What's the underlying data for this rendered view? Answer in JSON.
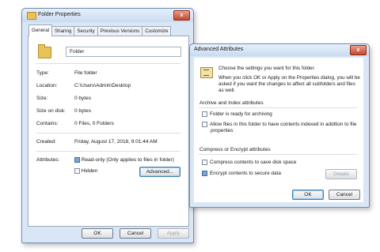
{
  "folder_properties": {
    "title": "Folder Properties",
    "close_label": "x",
    "tabs": [
      "General",
      "Sharing",
      "Security",
      "Previous Versions",
      "Customize"
    ],
    "name_value": "Folder",
    "fields": [
      {
        "label": "Type:",
        "value": "File folder"
      },
      {
        "label": "Location:",
        "value": "C:\\Users\\Admin\\Desktop"
      },
      {
        "label": "Size:",
        "value": "0 bytes"
      },
      {
        "label": "Size on disk:",
        "value": "0 bytes"
      },
      {
        "label": "Contains:",
        "value": "0 Files, 0 Folders"
      },
      {
        "label": "Created:",
        "value": "Friday, August 17, 2018, 9:01:44 AM"
      }
    ],
    "attributes_label": "Attributes:",
    "readonly_label": "Read-only (Only applies to files in folder)",
    "hidden_label": "Hidden",
    "advanced_label": "Advanced...",
    "ok_label": "OK",
    "cancel_label": "Cancel",
    "apply_label": "Apply"
  },
  "advanced_attributes": {
    "title": "Advanced Attributes",
    "close_label": "x",
    "description": [
      "Choose the settings you want for this folder.",
      "When you click OK or Apply on the Properties dialog, you will be",
      "asked if you want the changes to affect all subfolders and files",
      "as well."
    ],
    "archive_group": "Archive and Index attributes",
    "archive_option": "Folder is ready for archiving",
    "index_option_line1": "Allow files in this folder to have contents indexed in addition to file",
    "index_option_line2": "properties",
    "compress_group": "Compress or Encrypt attributes",
    "compress_option": "Compress contents to save disk space",
    "encrypt_option": "Encrypt contents to secure data",
    "details_label": "Details",
    "ok_label": "OK",
    "cancel_label": "Cancel"
  }
}
